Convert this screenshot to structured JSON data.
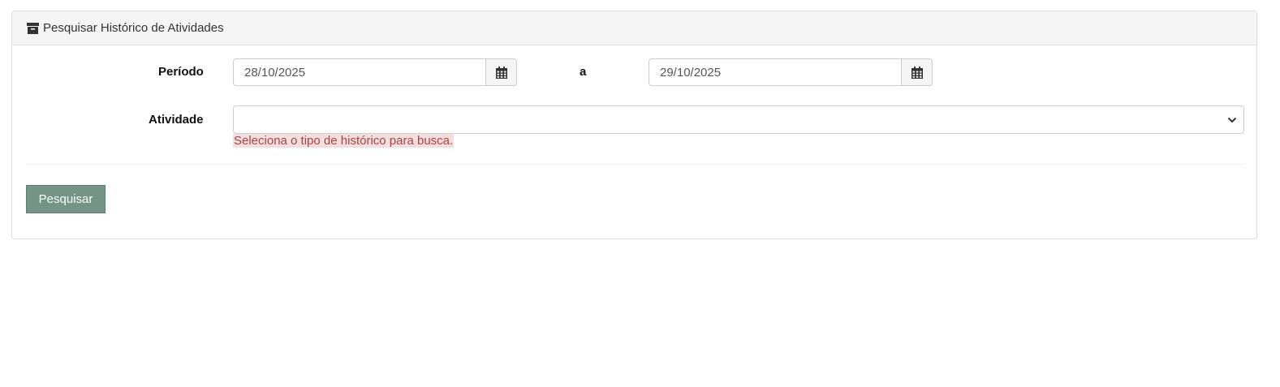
{
  "panel": {
    "title": "Pesquisar Histórico de Atividades",
    "icon": "archive-icon"
  },
  "form": {
    "period_label": "Período",
    "separator_label": "a",
    "date_from": "28/10/2025",
    "date_to": "29/10/2025",
    "calendar_icon": "calendar-icon",
    "activity_label": "Atividade",
    "activity_value": "",
    "activity_error": "Seleciona o tipo de histórico para busca."
  },
  "actions": {
    "search_label": "Pesquisar"
  },
  "colors": {
    "button_bg": "#739487",
    "error_text": "#a94442",
    "error_bg": "#f2dede",
    "heading_bg": "#f5f5f5"
  }
}
